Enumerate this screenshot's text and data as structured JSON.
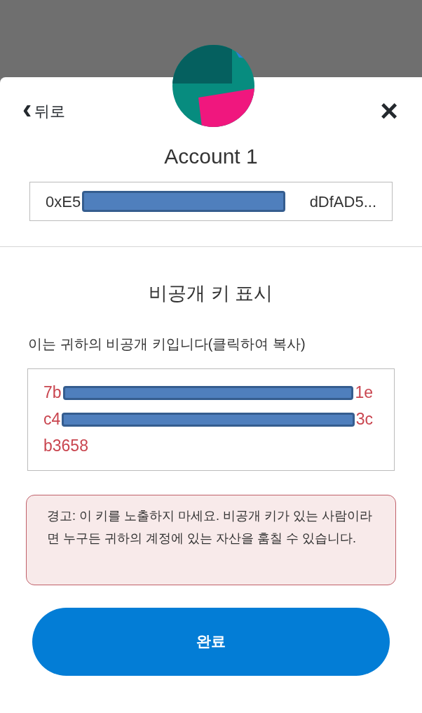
{
  "header": {
    "back": {
      "icon": "‹",
      "label": "뒤로"
    },
    "close": "×"
  },
  "account": {
    "name": "Account 1",
    "address": {
      "start": "0xE5",
      "end": "dDfAD5...",
      "redacted": true
    }
  },
  "section": {
    "title": "비공개 키 표시",
    "label": "이는 귀하의 비공개 키입니다(클릭하여 복사)",
    "key_lines": [
      {
        "start": "7b",
        "end": "1e",
        "redacted": true
      },
      {
        "start": "c4",
        "end": "3c",
        "redacted": true
      },
      {
        "start": "b3658",
        "redacted": false
      }
    ]
  },
  "warning": "경고: 이 키를 노출하지 마세요. 비공개 키가 있는 사람이라면 누구든 귀하의 계정에 있는 자산을 훔칠 수 있습니다.",
  "done_button": "완료"
}
